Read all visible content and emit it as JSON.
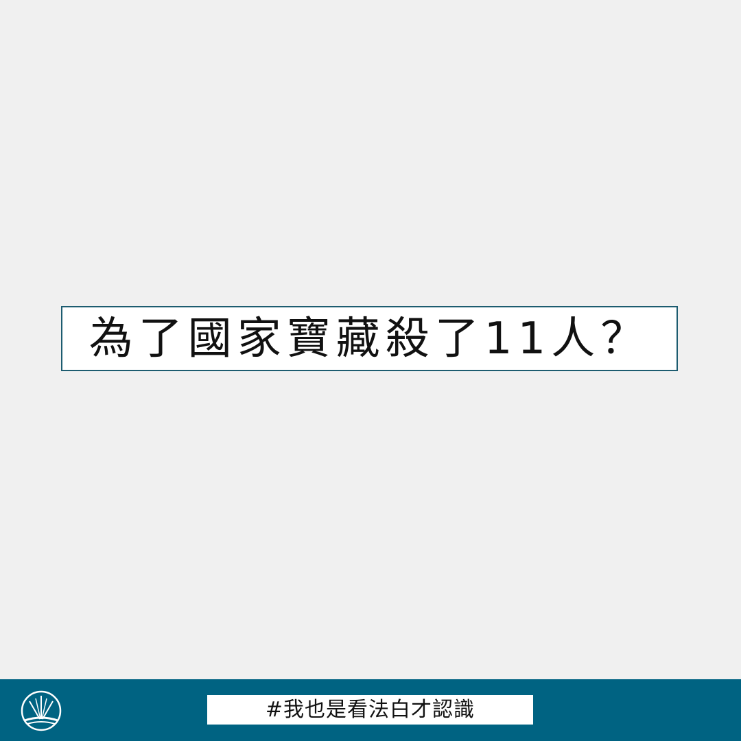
{
  "post": {
    "title": "為了國家寶藏殺了11人？"
  },
  "footer": {
    "hashtag": "#我也是看法白才認識",
    "logo_icon": "scales-logo-icon",
    "background_color": "#006382"
  },
  "colors": {
    "page_background": "#f0f0f0",
    "title_border": "#1d5c70",
    "text": "#111111"
  }
}
